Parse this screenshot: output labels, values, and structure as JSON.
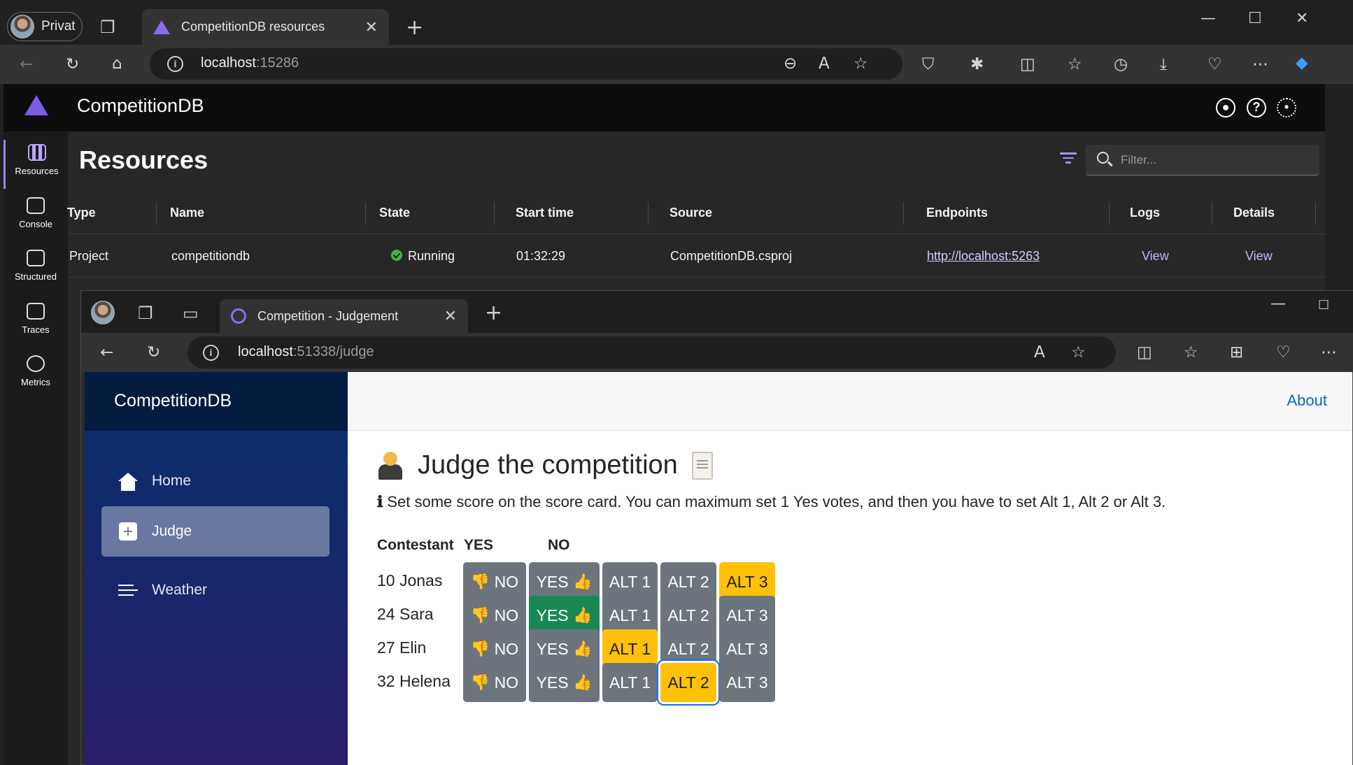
{
  "outer_browser": {
    "profile_label": "Privat",
    "tab_title": "CompetitionDB resources",
    "url_host": "localhost",
    "url_port": ":15286"
  },
  "dashboard": {
    "app_title": "CompetitionDB",
    "nav": [
      {
        "label": "Resources",
        "active": true
      },
      {
        "label": "Console",
        "active": false
      },
      {
        "label": "Structured",
        "active": false
      },
      {
        "label": "Traces",
        "active": false
      },
      {
        "label": "Metrics",
        "active": false
      }
    ],
    "page_title": "Resources",
    "filter_placeholder": "Filter...",
    "columns": [
      "Type",
      "Name",
      "State",
      "Start time",
      "Source",
      "Endpoints",
      "Logs",
      "Details"
    ],
    "row": {
      "type": "Project",
      "name": "competitiondb",
      "state": "Running",
      "start_time": "01:32:29",
      "source": "CompetitionDB.csproj",
      "endpoint": "http://localhost:5263",
      "logs": "View",
      "details": "View"
    }
  },
  "inner_browser": {
    "tab_title": "Competition - Judgement",
    "url_host": "localhost",
    "url_rest": ":51338/judge"
  },
  "app": {
    "brand": "CompetitionDB",
    "nav": [
      {
        "label": "Home",
        "icon": "home-icon"
      },
      {
        "label": "Judge",
        "icon": "plus-square-icon",
        "active": true
      },
      {
        "label": "Weather",
        "icon": "list-icon"
      }
    ],
    "about": "About",
    "heading": "Judge the competition",
    "info_icon": "ℹ",
    "info_text": "Set some score on the score card. You can maximum set 1 Yes votes, and then you have to set Alt 1, Alt 2 or Alt 3.",
    "headers": {
      "contestant": "Contestant",
      "yes": "YES",
      "no": "NO"
    },
    "button_labels": {
      "no": "NO",
      "yes": "YES",
      "alt1": "ALT 1",
      "alt2": "ALT 2",
      "alt3": "ALT 3"
    },
    "contestants": [
      {
        "name": "10 Jonas",
        "yes": false,
        "alt": 3
      },
      {
        "name": "24 Sara",
        "yes": true,
        "alt": 0
      },
      {
        "name": "27 Elin",
        "yes": false,
        "alt": 1
      },
      {
        "name": "32 Helena",
        "yes": false,
        "alt": 2
      }
    ],
    "colors": {
      "secondary": "#6c757d",
      "warning": "#ffc107",
      "success": "#198754",
      "link": "#0a66c2"
    }
  }
}
